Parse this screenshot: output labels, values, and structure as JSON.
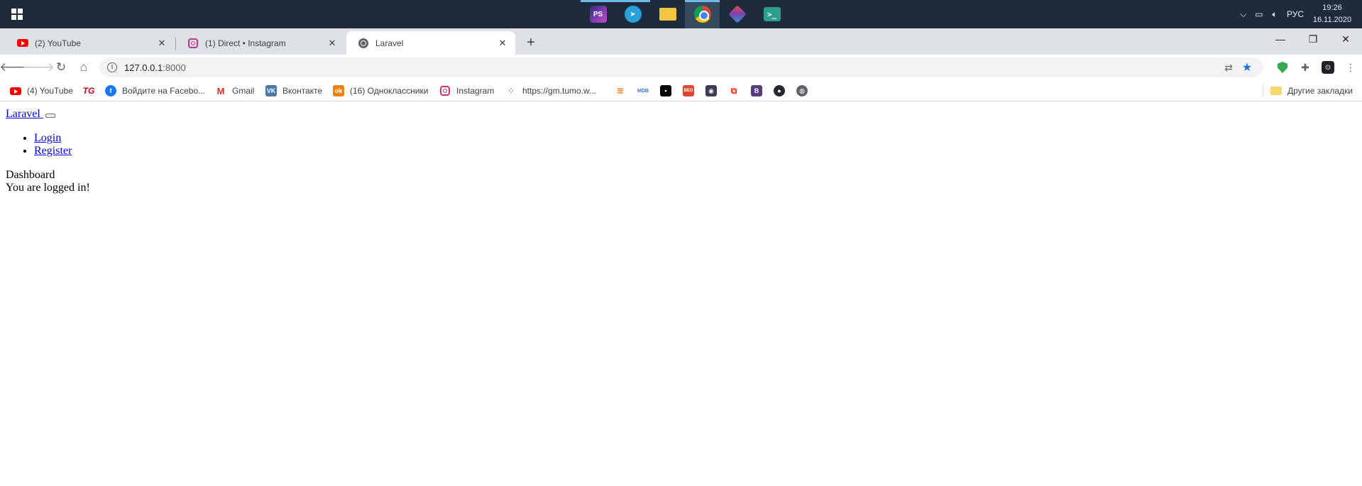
{
  "taskbar": {
    "apps": [
      {
        "name": "phpstorm",
        "label": "PS",
        "running": true,
        "active": false
      },
      {
        "name": "telegram",
        "label": "",
        "running": true,
        "active": false
      },
      {
        "name": "explorer",
        "label": "",
        "running": false,
        "active": false
      },
      {
        "name": "chrome",
        "label": "",
        "running": true,
        "active": true
      },
      {
        "name": "gitkraken",
        "label": "",
        "running": false,
        "active": false
      },
      {
        "name": "terminal",
        "label": ">_",
        "running": false,
        "active": false
      }
    ],
    "tray": {
      "language": "РУС",
      "time": "19:26",
      "date": "16.11.2020"
    }
  },
  "browser": {
    "tabs": [
      {
        "title": "(2) YouTube",
        "icon": "youtube-icon"
      },
      {
        "title": "(1) Direct • Instagram",
        "icon": "instagram-icon"
      },
      {
        "title": "Laravel",
        "icon": "globe-icon",
        "active": true
      }
    ],
    "address": {
      "host": "127.0.0.1",
      "port": ":8000"
    },
    "bookmarks": [
      {
        "label": "(4) YouTube",
        "icon": "youtube-icon"
      },
      {
        "label": "",
        "icon": "tg-logo-icon",
        "glyph": "TG"
      },
      {
        "label": "Войдите на Facebo...",
        "icon": "facebook-icon",
        "glyph": "f"
      },
      {
        "label": "Gmail",
        "icon": "gmail-icon",
        "glyph": "M"
      },
      {
        "label": "Вконтакте",
        "icon": "vk-icon",
        "glyph": "VK"
      },
      {
        "label": "(16) Одноклассники",
        "icon": "ok-icon",
        "glyph": "ok"
      },
      {
        "label": "Instagram",
        "icon": "instagram-icon"
      },
      {
        "label": "https://gm.tumo.w...",
        "icon": "dots-icon",
        "glyph": "⁘"
      },
      {
        "label": "",
        "icon": "stackoverflow-icon",
        "glyph": "≋"
      },
      {
        "label": "",
        "icon": "mdb-icon",
        "glyph": "MDB"
      },
      {
        "label": "",
        "icon": "jetbrains-icon",
        "glyph": "▪"
      },
      {
        "label": "",
        "icon": "beo-icon",
        "glyph": "BEO"
      },
      {
        "label": "",
        "icon": "dark-site-icon",
        "glyph": "◉"
      },
      {
        "label": "",
        "icon": "laravel-icon",
        "glyph": "⧉"
      },
      {
        "label": "",
        "icon": "bootstrap-icon",
        "glyph": "B"
      },
      {
        "label": "",
        "icon": "github-icon",
        "glyph": "●"
      },
      {
        "label": "",
        "icon": "globe-icon",
        "glyph": "◍"
      }
    ],
    "other_bookmarks": "Другие закладки"
  },
  "page": {
    "brand": "Laravel",
    "nav": {
      "login": "Login",
      "register": "Register"
    },
    "card_header": "Dashboard",
    "card_body": "You are logged in!"
  }
}
